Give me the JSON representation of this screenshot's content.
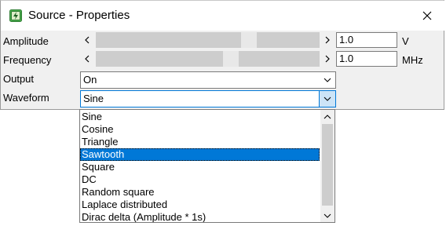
{
  "window": {
    "title": "Source - Properties",
    "icon": "lightning-app-icon",
    "close_icon": "close-icon"
  },
  "amplitude": {
    "label": "Amplitude",
    "value": "1.0",
    "unit": "V",
    "slider_fraction": 0.5
  },
  "frequency": {
    "label": "Frequency",
    "value": "1.0",
    "unit": "MHz",
    "slider_fraction": 0.47
  },
  "output": {
    "label": "Output",
    "selected": "On"
  },
  "waveform": {
    "label": "Waveform",
    "selected": "Sine",
    "options": [
      "Sine",
      "Cosine",
      "Triangle",
      "Sawtooth",
      "Square",
      "DC",
      "Random square",
      "Laplace distributed",
      "Dirac delta (Amplitude * 1s)"
    ],
    "highlighted": "Sawtooth"
  },
  "colors": {
    "selection": "#0078d7",
    "focus_border": "#0078d7",
    "icon_green": "#4caf50"
  }
}
